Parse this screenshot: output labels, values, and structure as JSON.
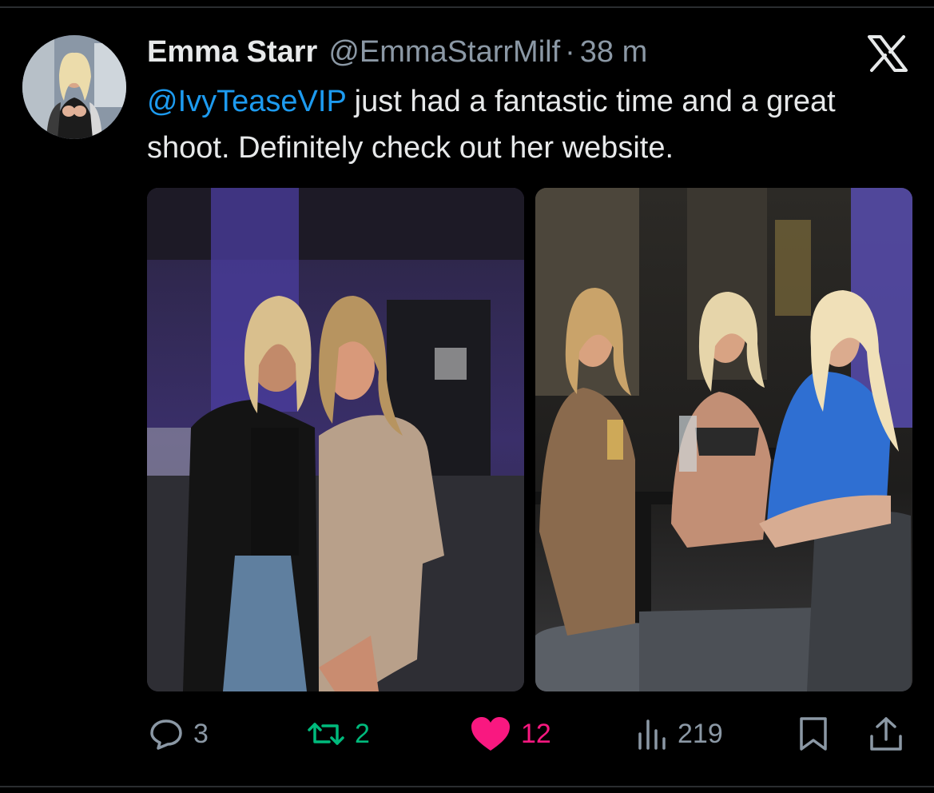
{
  "tweet": {
    "author_name": "Emma Starr",
    "author_handle": "@EmmaStarrMilf",
    "separator": "·",
    "time": "38 m",
    "mention": "@IvyTeaseVIP",
    "text_rest": " just had a fantastic time and a great shoot. Definitely check out her website."
  },
  "stats": {
    "replies": "3",
    "reposts": "2",
    "likes": "12",
    "views": "219"
  },
  "icons": {
    "logo": "x-logo-icon",
    "reply": "reply-icon",
    "repost": "repost-icon",
    "like": "heart-icon",
    "views": "views-icon",
    "bookmark": "bookmark-icon",
    "share": "share-icon"
  },
  "colors": {
    "background": "#000000",
    "text": "#e7e9ea",
    "secondary": "#8b98a5",
    "link": "#1d9bf0",
    "repost_active": "#00ba7c",
    "like_active": "#f91880"
  }
}
